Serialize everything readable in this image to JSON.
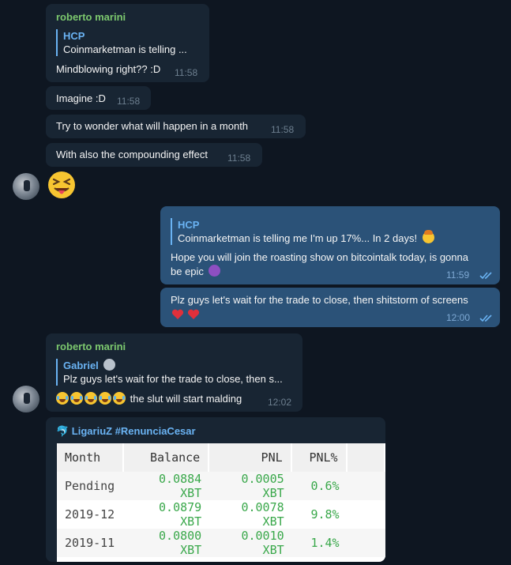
{
  "messages": {
    "m1": {
      "sender": "roberto marini",
      "quote_name": "HCP",
      "quote_text": "Coinmarketman is telling ...",
      "text": "Mindblowing right?? :D",
      "time": "11:58"
    },
    "m2": {
      "text": "Imagine :D",
      "time": "11:58"
    },
    "m3": {
      "text": "Try to wonder what will happen in a month",
      "time": "11:58"
    },
    "m4": {
      "text": "With also the compounding effect",
      "time": "11:58"
    },
    "m5": {
      "emoji": "squinting-face-with-tongue"
    },
    "m6": {
      "quote_name": "HCP",
      "quote_text": "Coinmarketman is telling me I'm up 17%... In 2 days!",
      "text_line1": "Hope you will join the roasting show on bitcointalk today, is gonna",
      "text_line2": "be epic",
      "time": "11:59"
    },
    "m7": {
      "text": "Plz guys let's wait for the trade to close, then shitstorm of screens",
      "time": "12:00"
    },
    "m8": {
      "sender": "roberto marini",
      "quote_name": "Gabriel",
      "quote_text": "Plz guys let's wait for the trade to close, then s...",
      "text": "the slut will start malding",
      "time": "12:02"
    }
  },
  "table_card": {
    "title": "🐬 LigariuZ #RenunciaCesar",
    "columns": [
      "Month",
      "Balance",
      "PNL",
      "PNL%"
    ],
    "rows": [
      {
        "month": "Pending",
        "balance": "0.0884 XBT",
        "pnl": "0.0005 XBT",
        "pnl_pct": "0.6%"
      },
      {
        "month": "2019-12",
        "balance": "0.0879 XBT",
        "pnl": "0.0078 XBT",
        "pnl_pct": "9.8%"
      },
      {
        "month": "2019-11",
        "balance": "0.0800 XBT",
        "pnl": "0.0010 XBT",
        "pnl_pct": "1.4%"
      }
    ]
  },
  "colors": {
    "background": "#0e1621",
    "incoming_bubble": "#182533",
    "outgoing_bubble": "#2b5278",
    "sender_name": "#7cc86e",
    "quote_accent": "#6ab3f3",
    "positive_value": "#3aa84b"
  }
}
